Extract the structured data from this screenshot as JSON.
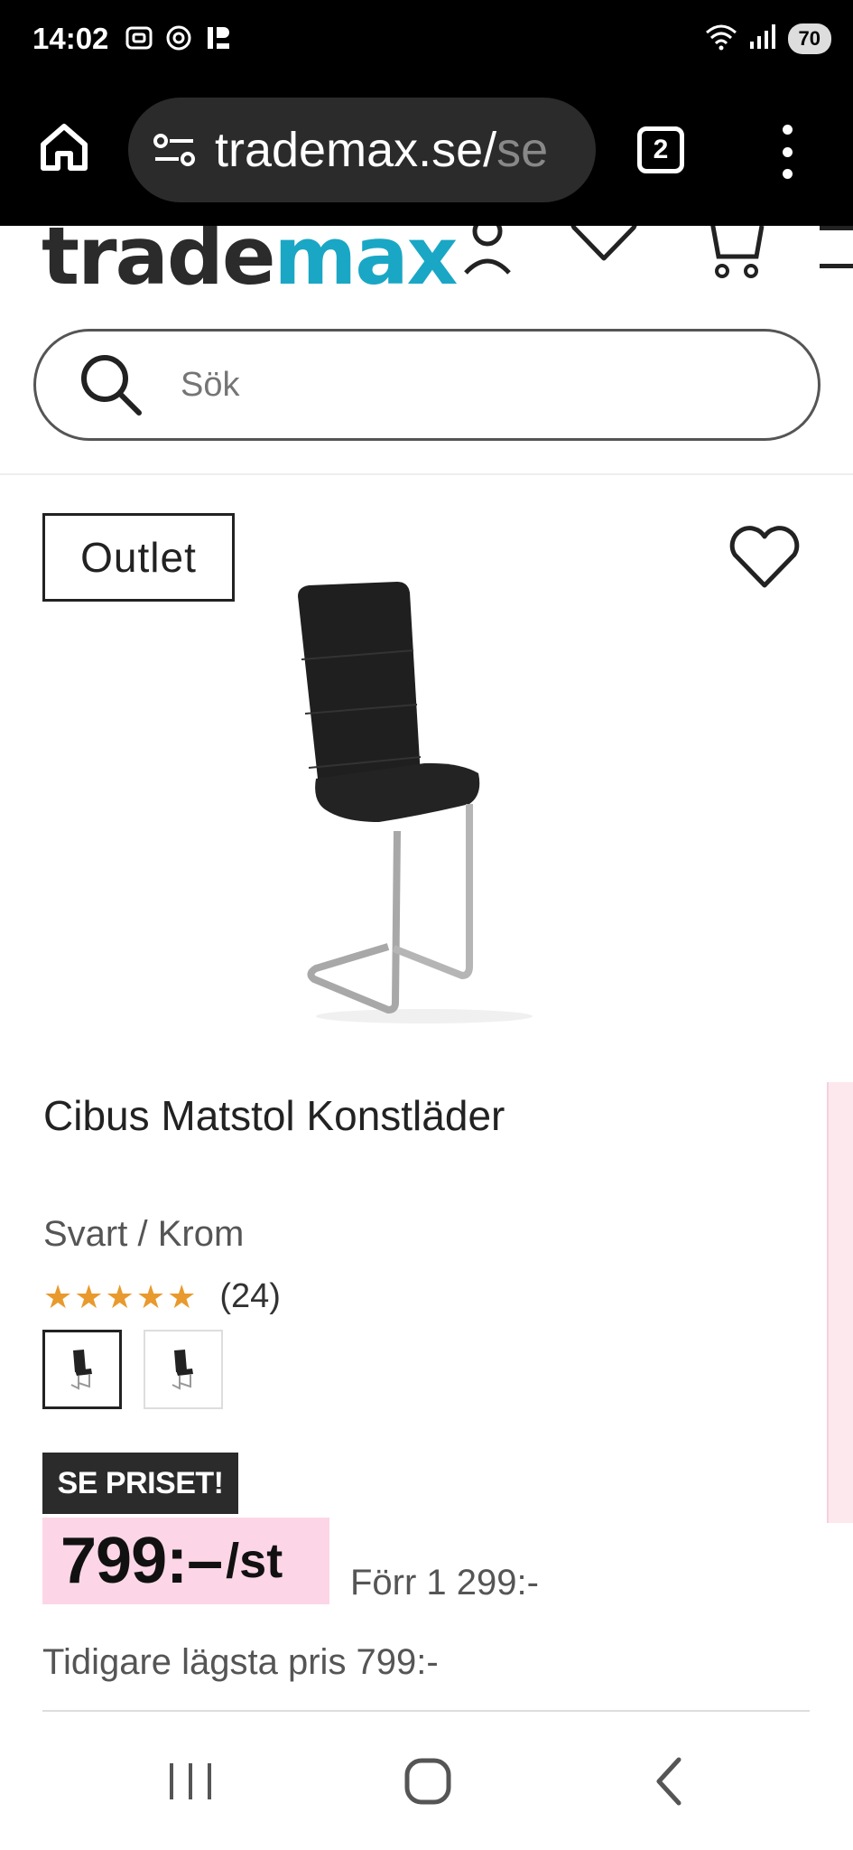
{
  "status_bar": {
    "time": "14:02",
    "battery": "70",
    "icons": [
      "screenshot-icon",
      "openai-icon",
      "p-icon",
      "wifi-icon",
      "signal-icon",
      "battery-icon"
    ]
  },
  "browser": {
    "url_main": "trademax.se/",
    "url_rest": "se",
    "tab_count": "2"
  },
  "site": {
    "logo_part1": "trade",
    "logo_part2": "max",
    "logo_color": "#1aa7c5",
    "search_placeholder": "Sök"
  },
  "product": {
    "badge": "Outlet",
    "title": "Cibus Matstol Konstläder",
    "variant": "Svart / Krom",
    "rating_stars": "★★★★★",
    "rating_value": 5,
    "review_count": "(24)",
    "promo_label": "SE PRISET!",
    "price": "799:–",
    "price_unit": "/st",
    "old_price": "Förr 1 299:-",
    "lowest_price": "Tidigare lägsta pris 799:-",
    "price_highlight_color": "#fcd6e6",
    "star_color": "#e89a2e"
  }
}
